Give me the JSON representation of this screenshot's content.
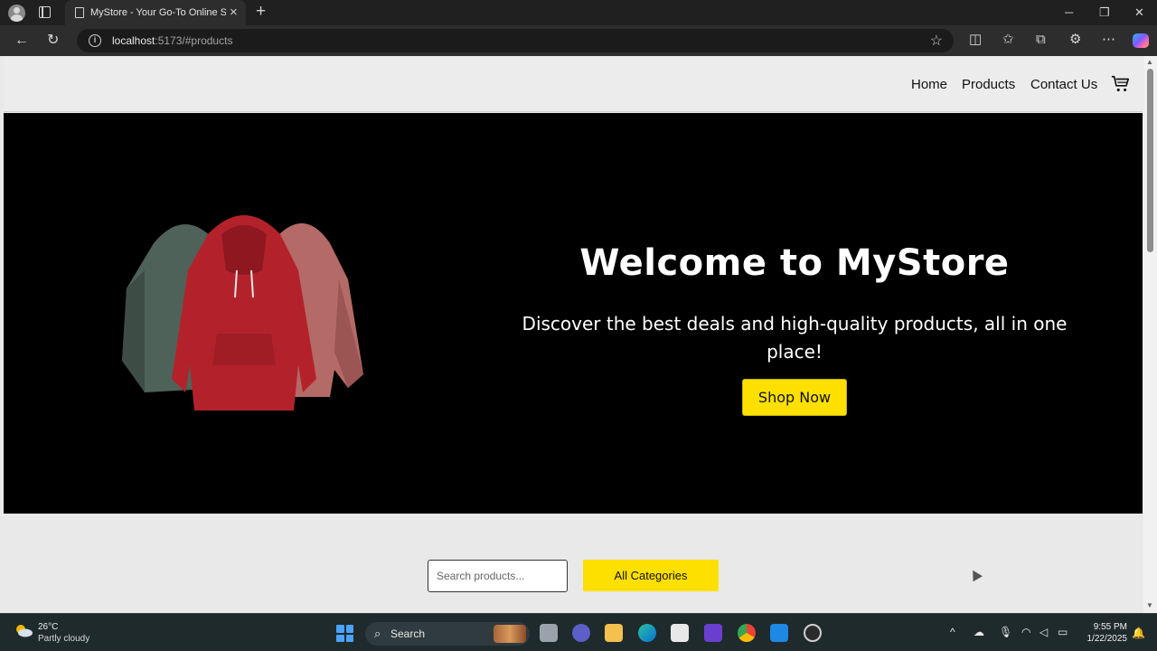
{
  "browser": {
    "tab_title": "MyStore - Your Go-To Online Store",
    "url_host": "localhost",
    "url_path": ":5173/#products",
    "icons": [
      "profile-icon",
      "tab-actions-icon",
      "close-icon",
      "new-tab-icon",
      "back-icon",
      "reload-icon",
      "info-icon",
      "favorite-star-icon",
      "split-screen-icon",
      "favorites-icon",
      "collections-icon",
      "extensions-icon",
      "more-icon",
      "copilot-icon",
      "minimize-icon",
      "restore-icon",
      "window-close-icon"
    ]
  },
  "site": {
    "nav": {
      "home": "Home",
      "products": "Products",
      "contact": "Contact Us"
    },
    "hero": {
      "title": "Welcome to MyStore",
      "subtitle": "Discover the best deals and high-quality products, all in one place!",
      "cta": "Shop Now"
    },
    "controls": {
      "search_placeholder": "Search products...",
      "category_button": "All Categories"
    },
    "colors": {
      "accent": "#fde000",
      "hero_bg": "#000000",
      "page_bg": "#e9e9e9"
    }
  },
  "taskbar": {
    "weather_temp": "26°C",
    "weather_desc": "Partly cloudy",
    "search_label": "Search",
    "time": "9:55 PM",
    "date": "1/22/2025",
    "apps": [
      "file-explorer-icon",
      "teams-icon",
      "folder-icon",
      "edge-icon",
      "store-icon",
      "visual-studio-icon",
      "chrome-icon",
      "vscode-icon",
      "obs-icon"
    ]
  }
}
